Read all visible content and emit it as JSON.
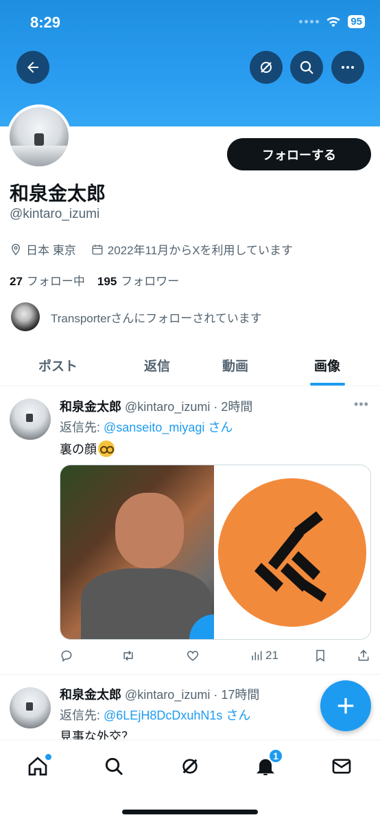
{
  "status_bar": {
    "time": "8:29",
    "battery": "95"
  },
  "header": {
    "back_icon": "arrow-left-icon",
    "grok_icon": "grok-icon",
    "search_icon": "search-icon",
    "more_icon": "more-horizontal-icon"
  },
  "profile": {
    "display_name": "和泉金太郎",
    "handle": "@kintaro_izumi",
    "follow_button": "フォローする",
    "location": "日本 東京",
    "joined": "2022年11月からXを利用しています",
    "following_count": "27",
    "following_label": "フォロー中",
    "followers_count": "195",
    "followers_label": "フォロワー",
    "followed_by": "Transporterさんにフォローされています"
  },
  "tabs": [
    {
      "label": "ポスト"
    },
    {
      "label": "返信"
    },
    {
      "label": "動画"
    },
    {
      "label": "画像"
    }
  ],
  "tweets": [
    {
      "name": "和泉金太郎",
      "meta": "@kintaro_izumi · 2時間",
      "reply_prefix": "返信先: ",
      "reply_mention": "@sanseito_miyagi",
      "reply_suffix": " さん",
      "text": "裏の顔",
      "more": "•••",
      "views": "21"
    },
    {
      "name": "和泉金太郎",
      "meta": "@kintaro_izumi · 17時間",
      "reply_prefix": "返信先: ",
      "reply_mention": "@6LEjH8DcDxuhN1s",
      "reply_suffix": " さん",
      "text": "見事な外交？"
    }
  ],
  "bottom_nav": {
    "items": [
      "home-icon",
      "search-icon",
      "grok-icon",
      "bell-icon",
      "mail-icon"
    ],
    "notifications_badge": "1"
  },
  "colors": {
    "accent": "#1d9bf0",
    "banner": "#2a9cf0",
    "text": "#0f1419",
    "muted": "#536471"
  }
}
